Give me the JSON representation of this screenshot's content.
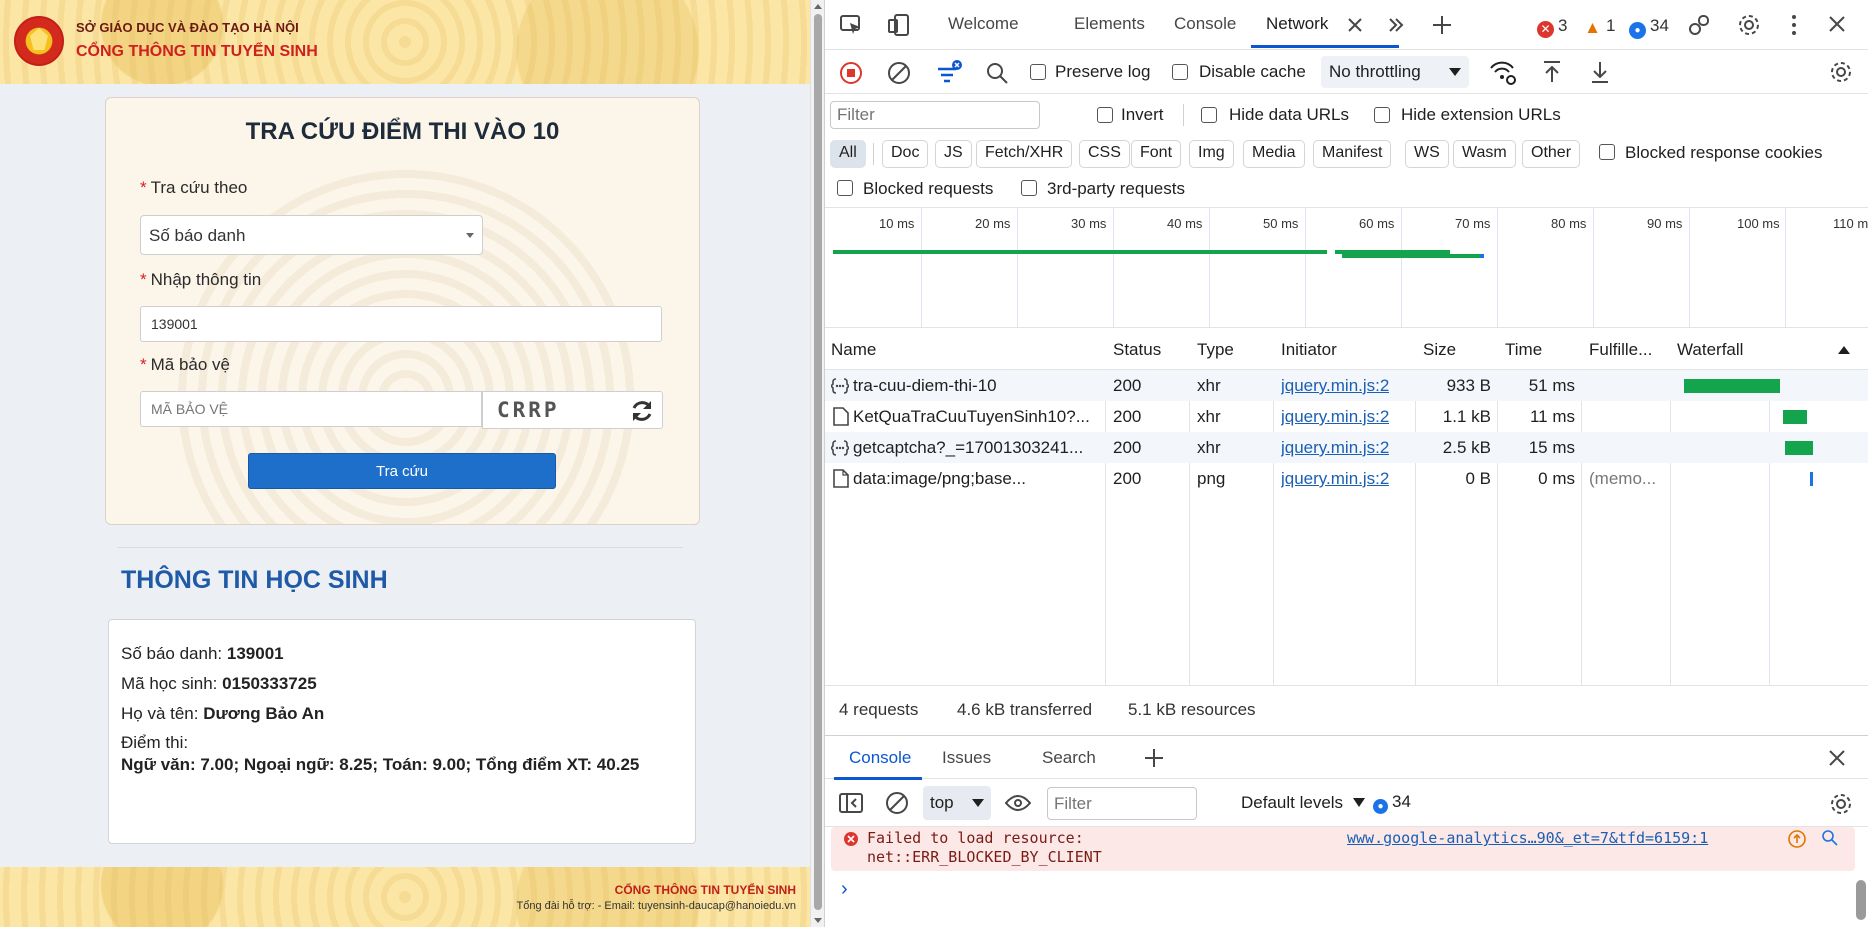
{
  "site": {
    "dept_name": "SỞ GIÁO DỤC VÀ ĐÀO TẠO HÀ NỘI",
    "portal_name": "CỔNG THÔNG TIN TUYỂN SINH",
    "logo_text": "SỞ GIÁO DỤC VÀ ĐÀO TẠO HÀ NỘI"
  },
  "search_form": {
    "title": "TRA CỨU ĐIỂM THI VÀO 10",
    "lookup_by_label": "Tra cứu theo",
    "lookup_by_value": "Số báo danh",
    "info_label": "Nhập thông tin",
    "info_value": "139001",
    "captcha_label": "Mã bảo vệ",
    "captcha_placeholder": "MÃ BẢO VỆ",
    "captcha_text": "CRRP",
    "submit_label": "Tra cứu",
    "required_mark": "*"
  },
  "student": {
    "heading": "THÔNG TIN HỌC SINH",
    "sbd_label": "Số báo danh: ",
    "sbd_value": "139001",
    "id_label": "Mã học sinh: ",
    "id_value": "0150333725",
    "name_label": "Họ và tên: ",
    "name_value": "Dương Bảo An",
    "score_label": "Điểm thi:",
    "score_value": "Ngữ văn: 7.00; Ngoại ngữ: 8.25; Toán: 9.00; Tổng điểm XT: 40.25"
  },
  "footer": {
    "title": "CỔNG THÔNG TIN TUYỂN SINH",
    "support": "Tổng đài hỗ trợ: - Email: tuyensinh-daucap@hanoiedu.vn"
  },
  "devtools": {
    "tabs": [
      "Welcome",
      "Elements",
      "Console",
      "Network"
    ],
    "active_tab": "Network",
    "counts": {
      "errors": "3",
      "warnings": "1",
      "messages": "34"
    },
    "toolbar": {
      "preserve_log": "Preserve log",
      "disable_cache": "Disable cache",
      "throttling": "No throttling"
    },
    "filter": {
      "placeholder": "Filter",
      "invert": "Invert",
      "hide_data_urls": "Hide data URLs",
      "hide_extension_urls": "Hide extension URLs",
      "types": [
        "All",
        "Doc",
        "JS",
        "Fetch/XHR",
        "CSS",
        "Font",
        "Img",
        "Media",
        "Manifest",
        "WS",
        "Wasm",
        "Other"
      ],
      "active_type": "All",
      "blocked_response_cookies": "Blocked response cookies",
      "blocked_requests": "Blocked requests",
      "third_party": "3rd-party requests"
    },
    "timeline_labels": [
      "10 ms",
      "20 ms",
      "30 ms",
      "40 ms",
      "50 ms",
      "60 ms",
      "70 ms",
      "80 ms",
      "90 ms",
      "100 ms",
      "110 ms"
    ],
    "columns": [
      "Name",
      "Status",
      "Type",
      "Initiator",
      "Size",
      "Time",
      "Fulfille...",
      "Waterfall"
    ],
    "requests": [
      {
        "name": "tra-cuu-diem-thi-10",
        "status": "200",
        "type": "xhr",
        "initiator": "jquery.min.js:2",
        "size": "933 B",
        "time": "51 ms",
        "fulfilled": "",
        "icon": "xhr-icon"
      },
      {
        "name": "KetQuaTraCuuTuyenSinh10?...",
        "status": "200",
        "type": "xhr",
        "initiator": "jquery.min.js:2",
        "size": "1.1 kB",
        "time": "11 ms",
        "fulfilled": "",
        "icon": "document-icon"
      },
      {
        "name": "getcaptcha?_=17001303241...",
        "status": "200",
        "type": "xhr",
        "initiator": "jquery.min.js:2",
        "size": "2.5 kB",
        "time": "15 ms",
        "fulfilled": "",
        "icon": "xhr-icon"
      },
      {
        "name": "data:image/png;base...",
        "status": "200",
        "type": "png",
        "initiator": "jquery.min.js:2",
        "size": "0 B",
        "time": "0 ms",
        "fulfilled": "(memo...",
        "icon": "file-icon"
      }
    ],
    "summary": {
      "requests": "4 requests",
      "transferred": "4.6 kB transferred",
      "resources": "5.1 kB resources"
    },
    "drawer_tabs": [
      "Console",
      "Issues",
      "Search"
    ],
    "console": {
      "context": "top",
      "filter_placeholder": "Filter",
      "levels": "Default levels",
      "message_count": "34",
      "error_line1": "Failed to load resource:",
      "error_line2": "net::ERR_BLOCKED_BY_CLIENT",
      "error_source": "www.google-analytics…90&_et=7&tfd=6159:1",
      "prompt": "›"
    }
  }
}
